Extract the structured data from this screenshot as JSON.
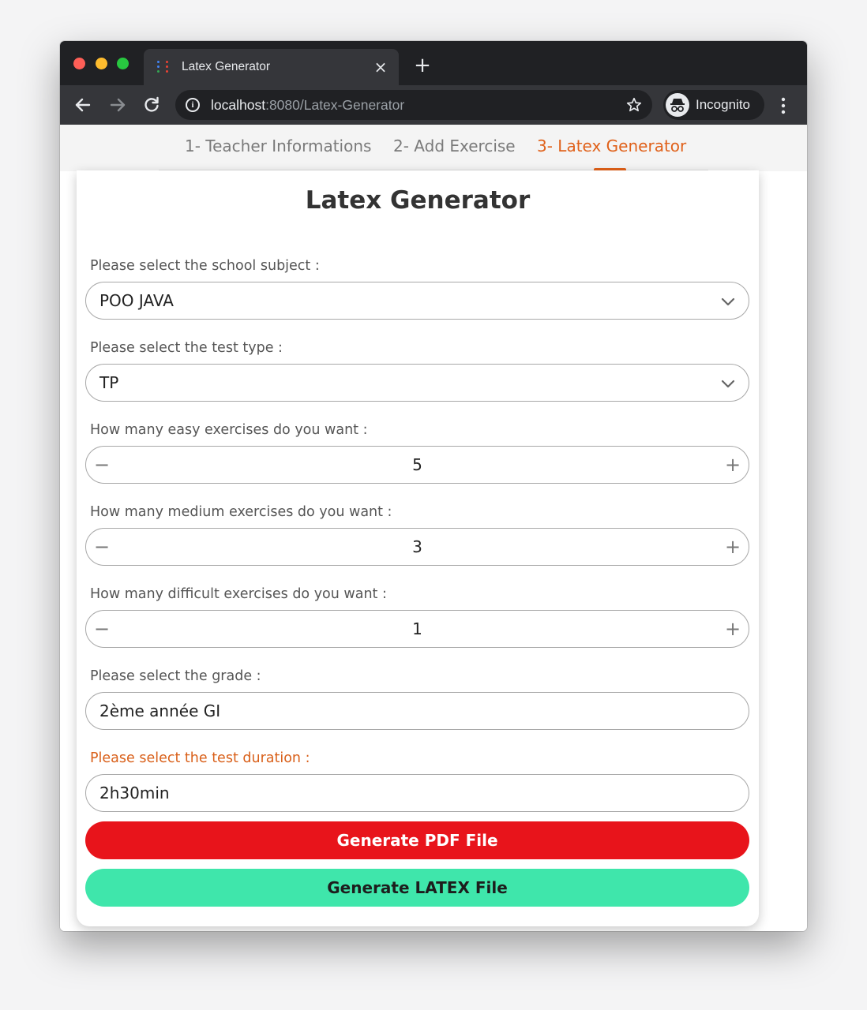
{
  "browser": {
    "tab_title": "Latex Generator",
    "tab_close_glyph": "×",
    "new_tab_glyph": "+",
    "url_host": "localhost",
    "url_rest": ":8080/Latex-Generator",
    "profile_label": "Incognito",
    "favicon_colors": [
      "#4285f4",
      "#ea4335",
      "#34a853",
      "#fbbc05"
    ]
  },
  "stepper": {
    "steps": [
      {
        "label": "1- Teacher Informations",
        "active": false
      },
      {
        "label": "2- Add Exercise",
        "active": false
      },
      {
        "label": "3- Latex Generator",
        "active": true
      }
    ],
    "accent_color": "#e0611a"
  },
  "form": {
    "title": "Latex Generator",
    "subject": {
      "label": "Please select the school subject :",
      "value": "POO JAVA"
    },
    "test_type": {
      "label": "Please select the test type :",
      "value": "TP"
    },
    "easy": {
      "label": "How many easy exercises do you want :",
      "value": "5",
      "minus": "−",
      "plus": "+"
    },
    "medium": {
      "label": "How many medium exercises do you want :",
      "value": "3",
      "minus": "−",
      "plus": "+"
    },
    "difficult": {
      "label": "How many difficult exercises do you want :",
      "value": "1",
      "minus": "−",
      "plus": "+"
    },
    "grade": {
      "label": "Please select the grade :",
      "value": "2ème année GI"
    },
    "duration": {
      "label": "Please select the test duration :",
      "value": "2h30min"
    },
    "pdf_button": "Generate PDF File",
    "latex_button": "Generate LATEX File",
    "pdf_button_color": "#e8141b",
    "latex_button_color": "#3fe6ab"
  }
}
